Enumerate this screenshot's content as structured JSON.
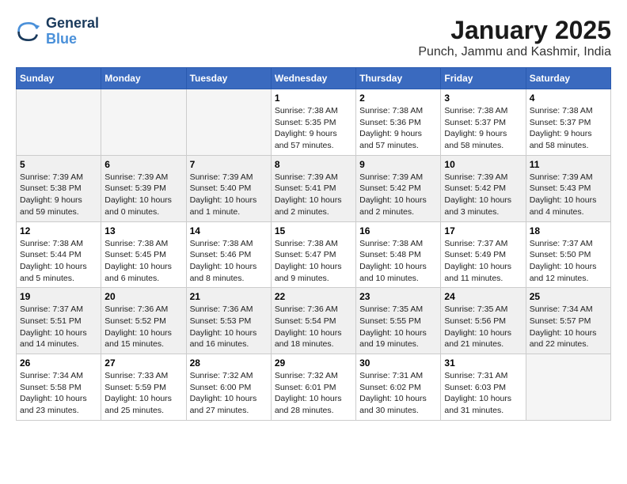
{
  "logo": {
    "line1": "General",
    "line2": "Blue"
  },
  "title": "January 2025",
  "subtitle": "Punch, Jammu and Kashmir, India",
  "days_of_week": [
    "Sunday",
    "Monday",
    "Tuesday",
    "Wednesday",
    "Thursday",
    "Friday",
    "Saturday"
  ],
  "weeks": [
    [
      {
        "num": "",
        "info": ""
      },
      {
        "num": "",
        "info": ""
      },
      {
        "num": "",
        "info": ""
      },
      {
        "num": "1",
        "info": "Sunrise: 7:38 AM\nSunset: 5:35 PM\nDaylight: 9 hours\nand 57 minutes."
      },
      {
        "num": "2",
        "info": "Sunrise: 7:38 AM\nSunset: 5:36 PM\nDaylight: 9 hours\nand 57 minutes."
      },
      {
        "num": "3",
        "info": "Sunrise: 7:38 AM\nSunset: 5:37 PM\nDaylight: 9 hours\nand 58 minutes."
      },
      {
        "num": "4",
        "info": "Sunrise: 7:38 AM\nSunset: 5:37 PM\nDaylight: 9 hours\nand 58 minutes."
      }
    ],
    [
      {
        "num": "5",
        "info": "Sunrise: 7:39 AM\nSunset: 5:38 PM\nDaylight: 9 hours\nand 59 minutes."
      },
      {
        "num": "6",
        "info": "Sunrise: 7:39 AM\nSunset: 5:39 PM\nDaylight: 10 hours\nand 0 minutes."
      },
      {
        "num": "7",
        "info": "Sunrise: 7:39 AM\nSunset: 5:40 PM\nDaylight: 10 hours\nand 1 minute."
      },
      {
        "num": "8",
        "info": "Sunrise: 7:39 AM\nSunset: 5:41 PM\nDaylight: 10 hours\nand 2 minutes."
      },
      {
        "num": "9",
        "info": "Sunrise: 7:39 AM\nSunset: 5:42 PM\nDaylight: 10 hours\nand 2 minutes."
      },
      {
        "num": "10",
        "info": "Sunrise: 7:39 AM\nSunset: 5:42 PM\nDaylight: 10 hours\nand 3 minutes."
      },
      {
        "num": "11",
        "info": "Sunrise: 7:39 AM\nSunset: 5:43 PM\nDaylight: 10 hours\nand 4 minutes."
      }
    ],
    [
      {
        "num": "12",
        "info": "Sunrise: 7:38 AM\nSunset: 5:44 PM\nDaylight: 10 hours\nand 5 minutes."
      },
      {
        "num": "13",
        "info": "Sunrise: 7:38 AM\nSunset: 5:45 PM\nDaylight: 10 hours\nand 6 minutes."
      },
      {
        "num": "14",
        "info": "Sunrise: 7:38 AM\nSunset: 5:46 PM\nDaylight: 10 hours\nand 8 minutes."
      },
      {
        "num": "15",
        "info": "Sunrise: 7:38 AM\nSunset: 5:47 PM\nDaylight: 10 hours\nand 9 minutes."
      },
      {
        "num": "16",
        "info": "Sunrise: 7:38 AM\nSunset: 5:48 PM\nDaylight: 10 hours\nand 10 minutes."
      },
      {
        "num": "17",
        "info": "Sunrise: 7:37 AM\nSunset: 5:49 PM\nDaylight: 10 hours\nand 11 minutes."
      },
      {
        "num": "18",
        "info": "Sunrise: 7:37 AM\nSunset: 5:50 PM\nDaylight: 10 hours\nand 12 minutes."
      }
    ],
    [
      {
        "num": "19",
        "info": "Sunrise: 7:37 AM\nSunset: 5:51 PM\nDaylight: 10 hours\nand 14 minutes."
      },
      {
        "num": "20",
        "info": "Sunrise: 7:36 AM\nSunset: 5:52 PM\nDaylight: 10 hours\nand 15 minutes."
      },
      {
        "num": "21",
        "info": "Sunrise: 7:36 AM\nSunset: 5:53 PM\nDaylight: 10 hours\nand 16 minutes."
      },
      {
        "num": "22",
        "info": "Sunrise: 7:36 AM\nSunset: 5:54 PM\nDaylight: 10 hours\nand 18 minutes."
      },
      {
        "num": "23",
        "info": "Sunrise: 7:35 AM\nSunset: 5:55 PM\nDaylight: 10 hours\nand 19 minutes."
      },
      {
        "num": "24",
        "info": "Sunrise: 7:35 AM\nSunset: 5:56 PM\nDaylight: 10 hours\nand 21 minutes."
      },
      {
        "num": "25",
        "info": "Sunrise: 7:34 AM\nSunset: 5:57 PM\nDaylight: 10 hours\nand 22 minutes."
      }
    ],
    [
      {
        "num": "26",
        "info": "Sunrise: 7:34 AM\nSunset: 5:58 PM\nDaylight: 10 hours\nand 23 minutes."
      },
      {
        "num": "27",
        "info": "Sunrise: 7:33 AM\nSunset: 5:59 PM\nDaylight: 10 hours\nand 25 minutes."
      },
      {
        "num": "28",
        "info": "Sunrise: 7:32 AM\nSunset: 6:00 PM\nDaylight: 10 hours\nand 27 minutes."
      },
      {
        "num": "29",
        "info": "Sunrise: 7:32 AM\nSunset: 6:01 PM\nDaylight: 10 hours\nand 28 minutes."
      },
      {
        "num": "30",
        "info": "Sunrise: 7:31 AM\nSunset: 6:02 PM\nDaylight: 10 hours\nand 30 minutes."
      },
      {
        "num": "31",
        "info": "Sunrise: 7:31 AM\nSunset: 6:03 PM\nDaylight: 10 hours\nand 31 minutes."
      },
      {
        "num": "",
        "info": ""
      }
    ]
  ]
}
